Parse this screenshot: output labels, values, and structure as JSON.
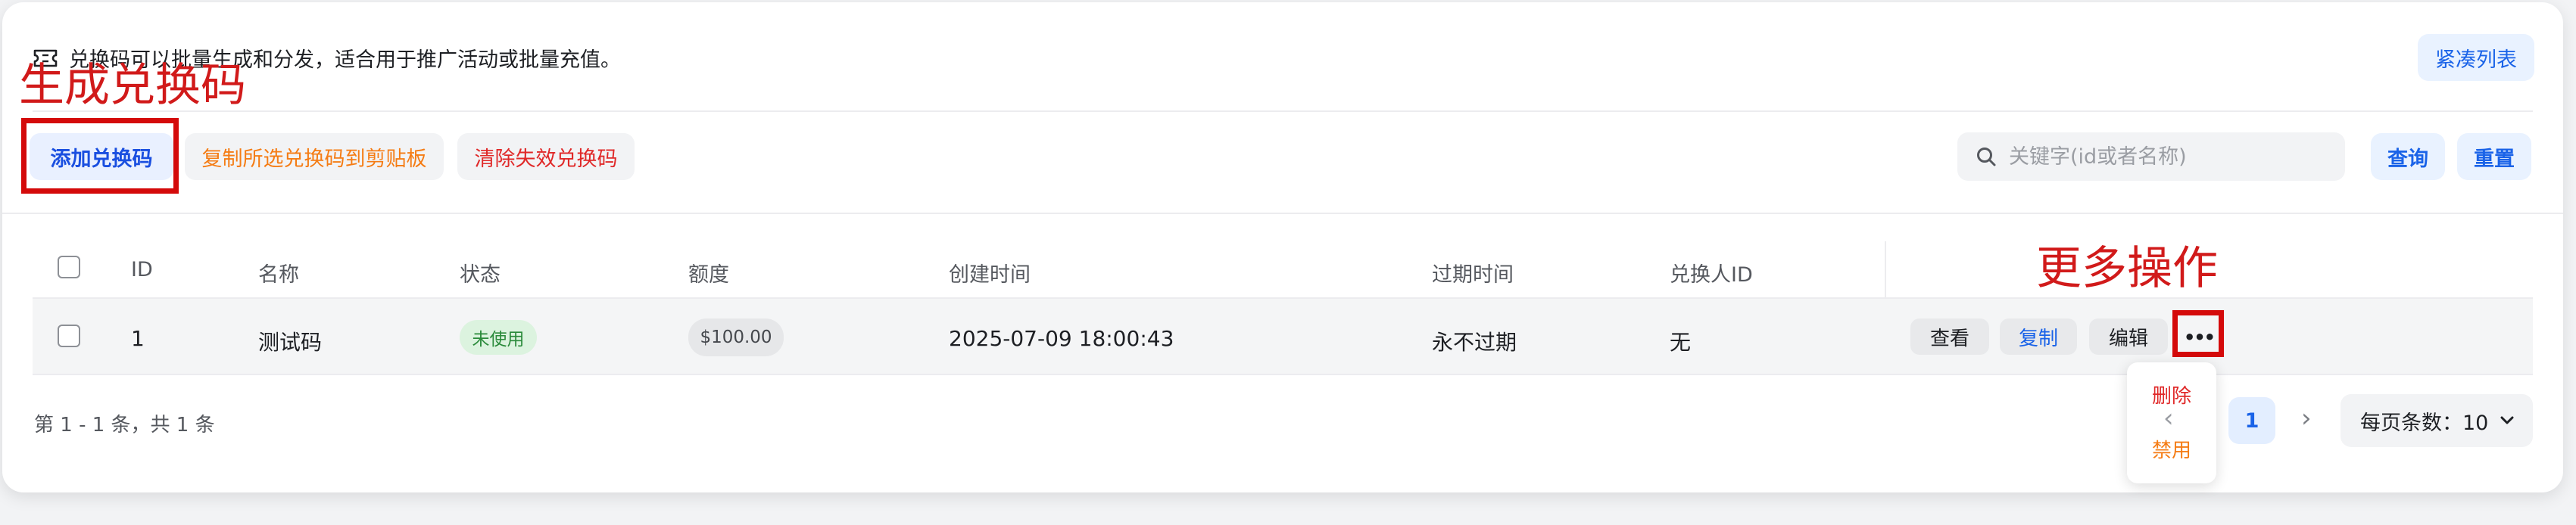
{
  "notice": {
    "icon": "ticket-icon",
    "text": "兑换码可以批量生成和分发，适合用于推广活动或批量充值。"
  },
  "compact_label": "紧凑列表",
  "annotations": {
    "generate": "生成兑换码",
    "more": "更多操作",
    "color": "#d11a1a"
  },
  "toolbar": {
    "add_label": "添加兑换码",
    "copy_label": "复制所选兑换码到剪贴板",
    "clear_label": "清除失效兑换码",
    "search_placeholder": "关键字(id或者名称)",
    "query_label": "查询",
    "reset_label": "重置"
  },
  "table": {
    "headers": [
      "ID",
      "名称",
      "状态",
      "额度",
      "创建时间",
      "过期时间",
      "兑换人ID"
    ],
    "rows": [
      {
        "id": "1",
        "name": "测试码",
        "status": "未使用",
        "amount": "$100.00",
        "created": "2025-07-09 18:00:43",
        "expires": "永不过期",
        "redeemer": "无"
      }
    ]
  },
  "actions": {
    "view": "查看",
    "copy": "复制",
    "edit": "编辑",
    "more": "•••"
  },
  "more_menu": {
    "delete": "删除",
    "disable": "禁用"
  },
  "pagination": {
    "summary": "第 1 - 1 条，共 1 条",
    "current_page": "1",
    "page_size": "每页条数：10"
  },
  "colors": {
    "primary": "#1a63e8",
    "danger": "#e02828",
    "warning": "#f57c14",
    "success": "#2a8a3a"
  }
}
